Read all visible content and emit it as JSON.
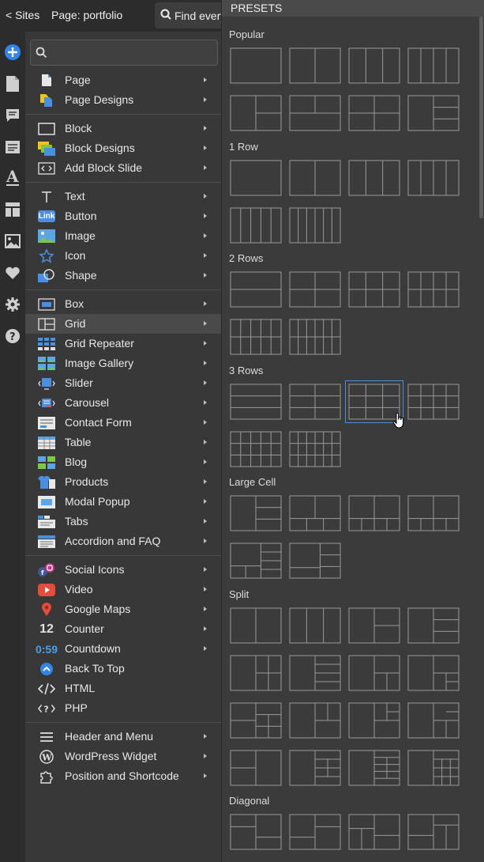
{
  "topbar": {
    "sites": "< Sites",
    "page": "Page: portfolio",
    "find": "Find every"
  },
  "iconbar": [
    "add-icon",
    "page-icon",
    "comment-icon",
    "form-icon",
    "typography-icon",
    "layout-icon",
    "image-icon",
    "heart-icon",
    "gear-icon",
    "help-icon"
  ],
  "menu": {
    "search_placeholder": "",
    "items": [
      {
        "label": "Page",
        "icon": "page-icon"
      },
      {
        "label": "Page Designs",
        "icon": "page-designs-icon"
      },
      {
        "label": "Block",
        "icon": "block-icon"
      },
      {
        "label": "Block Designs",
        "icon": "block-designs-icon"
      },
      {
        "label": "Add Block Slide",
        "icon": "add-block-slide-icon"
      },
      {
        "label": "Text",
        "icon": "text-icon"
      },
      {
        "label": "Button",
        "icon": "link-button-icon",
        "icon_text": "Link"
      },
      {
        "label": "Image",
        "icon": "image-icon"
      },
      {
        "label": "Icon",
        "icon": "star-icon"
      },
      {
        "label": "Shape",
        "icon": "shape-icon"
      },
      {
        "label": "Box",
        "icon": "box-icon"
      },
      {
        "label": "Grid",
        "icon": "grid-icon"
      },
      {
        "label": "Grid Repeater",
        "icon": "grid-repeater-icon"
      },
      {
        "label": "Image Gallery",
        "icon": "image-gallery-icon"
      },
      {
        "label": "Slider",
        "icon": "slider-icon"
      },
      {
        "label": "Carousel",
        "icon": "carousel-icon"
      },
      {
        "label": "Contact Form",
        "icon": "contact-form-icon"
      },
      {
        "label": "Table",
        "icon": "table-icon"
      },
      {
        "label": "Blog",
        "icon": "blog-icon"
      },
      {
        "label": "Products",
        "icon": "products-icon"
      },
      {
        "label": "Modal Popup",
        "icon": "modal-popup-icon"
      },
      {
        "label": "Tabs",
        "icon": "tabs-icon"
      },
      {
        "label": "Accordion and FAQ",
        "icon": "accordion-icon"
      },
      {
        "label": "Social Icons",
        "icon": "social-icons-icon"
      },
      {
        "label": "Video",
        "icon": "video-icon"
      },
      {
        "label": "Google Maps",
        "icon": "map-pin-icon"
      },
      {
        "label": "Counter",
        "icon": "counter-icon",
        "icon_text": "12"
      },
      {
        "label": "Countdown",
        "icon": "countdown-icon",
        "icon_text": "0:59"
      },
      {
        "label": "Back To Top",
        "icon": "back-to-top-icon"
      },
      {
        "label": "HTML",
        "icon": "html-code-icon"
      },
      {
        "label": "PHP",
        "icon": "php-code-icon"
      },
      {
        "label": "Header and Menu",
        "icon": "menu-icon"
      },
      {
        "label": "WordPress Widget",
        "icon": "wordpress-icon"
      },
      {
        "label": "Position and Shortcode",
        "icon": "puzzle-icon"
      }
    ],
    "selected": "Grid"
  },
  "presets": {
    "header": "PRESETS",
    "sections": [
      "Popular",
      "1 Row",
      "2 Rows",
      "3 Rows",
      "Large Cell",
      "Split",
      "Diagonal"
    ],
    "selected_preset": "3 Rows, item 3"
  },
  "colors": {
    "accent": "#4a8fe0",
    "menu_bg": "#383838",
    "bar_bg": "#2c2c2c"
  }
}
